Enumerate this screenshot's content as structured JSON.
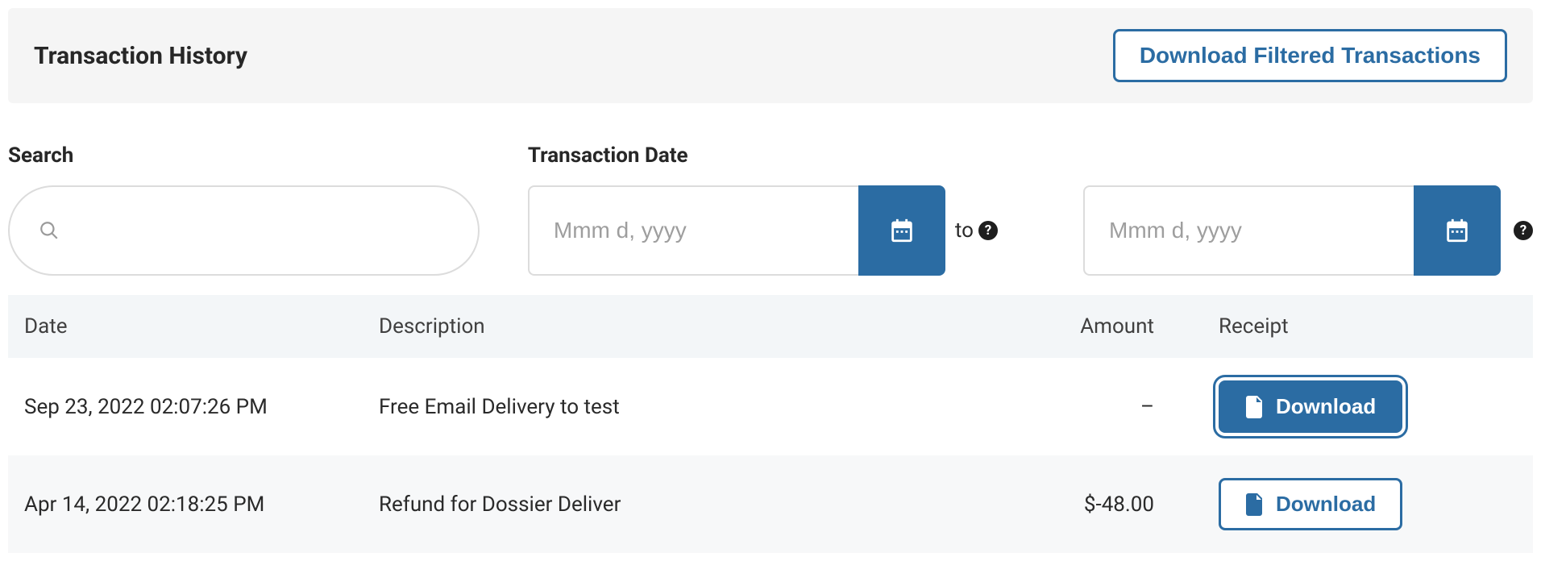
{
  "header": {
    "title": "Transaction History",
    "download_filtered_label": "Download Filtered Transactions"
  },
  "filters": {
    "search_label": "Search",
    "date_label": "Transaction Date",
    "date_from_placeholder": "Mmm d, yyyy",
    "date_to_placeholder": "Mmm d, yyyy",
    "to_label": "to"
  },
  "table": {
    "columns": {
      "date": "Date",
      "description": "Description",
      "amount": "Amount",
      "receipt": "Receipt"
    },
    "download_label": "Download",
    "rows": [
      {
        "date": "Sep 23, 2022 02:07:26 PM",
        "description": "Free Email Delivery to test",
        "amount": "–"
      },
      {
        "date": "Apr 14, 2022 02:18:25 PM",
        "description": "Refund for Dossier Deliver",
        "amount": "$-48.00"
      }
    ]
  }
}
